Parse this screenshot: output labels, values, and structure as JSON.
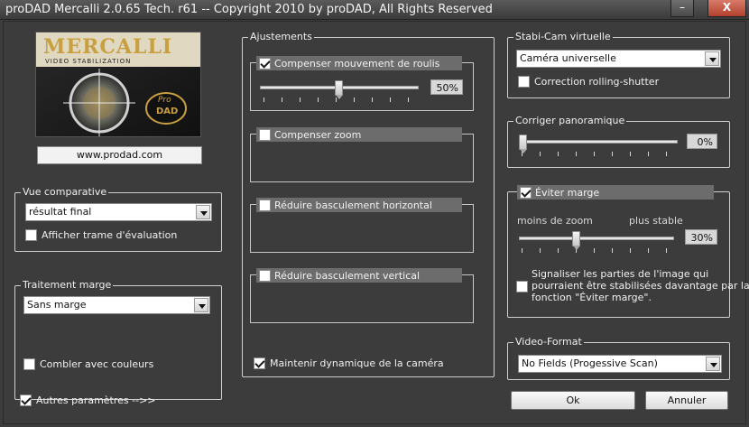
{
  "window": {
    "title": "proDAD Mercalli 2.0.65 Tech. r61 -- Copyright 2010 by proDAD, All Rights Reserved",
    "minimize_glyph": "–",
    "close_glyph": "X"
  },
  "logo": {
    "brand": "MERCALLI",
    "tagline": "VIDEO STABILIZATION",
    "badge_line1": "Pro",
    "badge_line2": "DAD"
  },
  "website": "www.prodad.com",
  "vue_comparative": {
    "title": "Vue comparative",
    "selected": "résultat final",
    "checkbox_label": "Afficher trame d'évaluation",
    "checkbox_checked": false
  },
  "traitement_marge": {
    "title": "Traitement marge",
    "selected": "Sans marge",
    "checkbox_label": "Combler avec couleurs",
    "checkbox_checked": false
  },
  "autres_parametres": {
    "label": "Autres paramètres -->>",
    "checked": true
  },
  "ajustements": {
    "title": "Ajustements",
    "roulis": {
      "label": "Compenser mouvement de roulis",
      "checked": true,
      "value_label": "50%",
      "value": 50
    },
    "zoom": {
      "label": "Compenser zoom",
      "checked": false
    },
    "horizontal": {
      "label": "Réduire basculement horizontal",
      "checked": false
    },
    "vertical": {
      "label": "Réduire basculement vertical",
      "checked": false
    },
    "dynamique": {
      "label": "Maintenir dynamique de la caméra",
      "checked": true
    }
  },
  "stabicam": {
    "title": "Stabi-Cam virtuelle",
    "selected": "Caméra universelle",
    "rolling_label": "Correction rolling-shutter",
    "rolling_checked": false
  },
  "panoramique": {
    "title": "Corriger panoramique",
    "value_label": "0%",
    "value": 0
  },
  "eviter_marge": {
    "title": "Éviter marge",
    "checked": true,
    "left_label": "moins de zoom",
    "right_label": "plus stable",
    "value_label": "30%",
    "value": 30,
    "signal_line1": "Signaliser les parties de l'image qui",
    "signal_line2": "pourraient être stabilisées davantage par la",
    "signal_line3": "fonction \"Éviter marge\".",
    "signal_checked": false
  },
  "video_format": {
    "title": "Video-Format",
    "selected": "No Fields (Progessive Scan)"
  },
  "buttons": {
    "ok": "Ok",
    "cancel": "Annuler"
  }
}
